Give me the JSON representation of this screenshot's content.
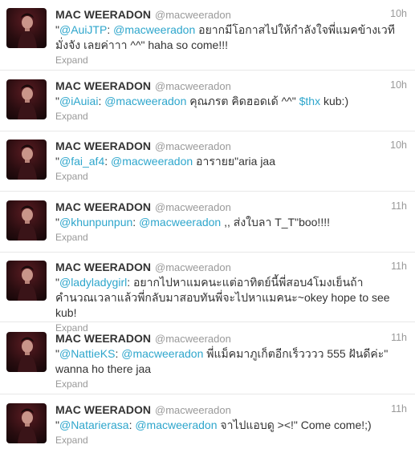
{
  "tweets": [
    {
      "fullname": "MAC WEERADON",
      "username": "@macweeradon",
      "time": "10h",
      "segments": [
        {
          "t": "\"",
          "link": false
        },
        {
          "t": "@AuiJTP",
          "link": true
        },
        {
          "t": ": ",
          "link": false
        },
        {
          "t": "@macweeradon",
          "link": true
        },
        {
          "t": " อยากมีโอกาสไปให้กำลังใจพี่แมคข้างเวทีมั่งจัง เลยค่าาา ^^\" haha so come!!!",
          "link": false
        }
      ],
      "expand": "Expand"
    },
    {
      "fullname": "MAC WEERADON",
      "username": "@macweeradon",
      "time": "10h",
      "segments": [
        {
          "t": "\"",
          "link": false
        },
        {
          "t": "@iAuiai",
          "link": true
        },
        {
          "t": ": ",
          "link": false
        },
        {
          "t": "@macweeradon",
          "link": true
        },
        {
          "t": " คุณภรต คิดฮอดเด้ ^^\" ",
          "link": false
        },
        {
          "t": "$thx",
          "link": true
        },
        {
          "t": " kub:)",
          "link": false
        }
      ],
      "expand": "Expand"
    },
    {
      "fullname": "MAC WEERADON",
      "username": "@macweeradon",
      "time": "10h",
      "segments": [
        {
          "t": "\"",
          "link": false
        },
        {
          "t": "@fai_af4",
          "link": true
        },
        {
          "t": ": ",
          "link": false
        },
        {
          "t": "@macweeradon",
          "link": true
        },
        {
          "t": " อารายย\"aria jaa",
          "link": false
        }
      ],
      "expand": "Expand"
    },
    {
      "fullname": "MAC WEERADON",
      "username": "@macweeradon",
      "time": "11h",
      "segments": [
        {
          "t": "\"",
          "link": false
        },
        {
          "t": "@khunpunpun",
          "link": true
        },
        {
          "t": ": ",
          "link": false
        },
        {
          "t": "@macweeradon",
          "link": true
        },
        {
          "t": " ,, ส่งใบลา T_T\"boo!!!!",
          "link": false
        }
      ],
      "expand": "Expand"
    },
    {
      "fullname": "MAC WEERADON",
      "username": "@macweeradon",
      "time": "11h",
      "segments": [
        {
          "t": "\"",
          "link": false
        },
        {
          "t": "@ladyladygirl",
          "link": true
        },
        {
          "t": ": อยากไปหาแมคนะแต่อาทิตย์นี้พี่สอบ4โมงเย็นถ้าคำนวณเวลาแล้วพี่กลับมาสอบทันพี่จะไปหาแมคนะ~okey hope to see kub!",
          "link": false
        }
      ],
      "expand": "Expand"
    },
    {
      "fullname": "MAC WEERADON",
      "username": "@macweeradon",
      "time": "11h",
      "segments": [
        {
          "t": "\"",
          "link": false
        },
        {
          "t": "@NattieKS",
          "link": true
        },
        {
          "t": ": ",
          "link": false
        },
        {
          "t": "@macweeradon",
          "link": true
        },
        {
          "t": " พี่แม็คมาภูเก็ตอีกเร็วววว 555 ฝันดีค่ะ\" wanna ho there jaa",
          "link": false
        }
      ],
      "expand": "Expand"
    },
    {
      "fullname": "MAC WEERADON",
      "username": "@macweeradon",
      "time": "11h",
      "segments": [
        {
          "t": "\"",
          "link": false
        },
        {
          "t": "@Natarierasa",
          "link": true
        },
        {
          "t": ": ",
          "link": false
        },
        {
          "t": "@macweeradon",
          "link": true
        },
        {
          "t": " จาไปแอบดู ><!\" Come come!;)",
          "link": false
        }
      ],
      "expand": "Expand"
    }
  ]
}
